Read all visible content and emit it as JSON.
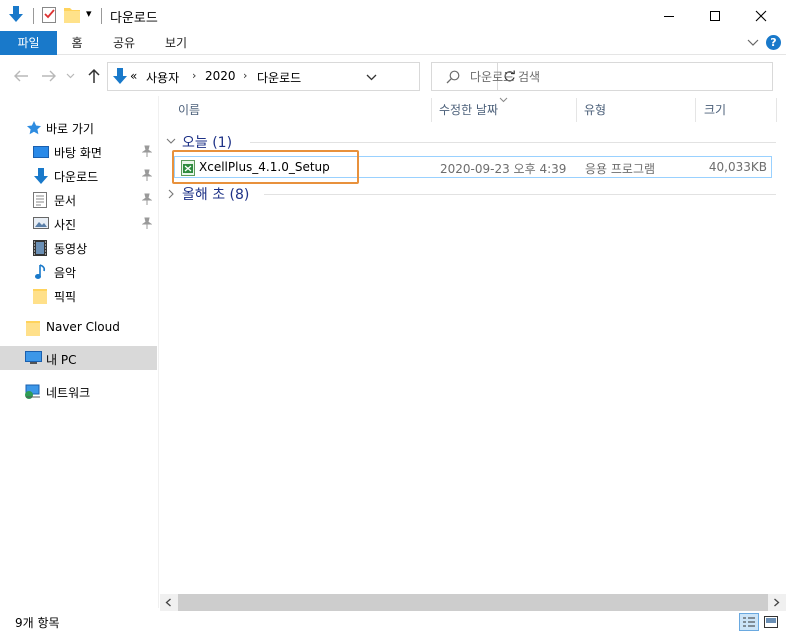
{
  "window": {
    "title": "다운로드",
    "qat_dropdown": "▾"
  },
  "ribbon": {
    "tabs": [
      "파일",
      "홈",
      "공유",
      "보기"
    ],
    "help": "?"
  },
  "address": {
    "overflow": "«",
    "crumbs": [
      "사용자",
      "2020",
      "다운로드"
    ],
    "search_placeholder": "다운로드 검색"
  },
  "nav": {
    "quick_access": "바로 가기",
    "items": [
      {
        "label": "바탕 화면",
        "icon": "desktop-icon",
        "pinned": true
      },
      {
        "label": "다운로드",
        "icon": "download-icon",
        "pinned": true
      },
      {
        "label": "문서",
        "icon": "document-icon",
        "pinned": true
      },
      {
        "label": "사진",
        "icon": "picture-icon",
        "pinned": true
      },
      {
        "label": "동영상",
        "icon": "video-icon",
        "pinned": false
      },
      {
        "label": "음악",
        "icon": "music-icon",
        "pinned": false
      },
      {
        "label": "픽픽",
        "icon": "folder-icon",
        "pinned": false
      }
    ],
    "naver_cloud": "Naver Cloud",
    "this_pc": "내 PC",
    "network": "네트워크"
  },
  "columns": {
    "name": "이름",
    "modified": "수정한 날짜",
    "type": "유형",
    "size": "크기"
  },
  "groups": [
    {
      "label": "오늘 (1)",
      "expanded": true
    },
    {
      "label": "올해 초 (8)",
      "expanded": false
    }
  ],
  "files": [
    {
      "name": "XcellPlus_4.1.0_Setup",
      "modified": "2020-09-23 오후 4:39",
      "type": "응용 프로그램",
      "size": "40,033KB"
    }
  ],
  "status": {
    "item_count": "9개 항목"
  },
  "colors": {
    "accent": "#1979ca",
    "highlight": "#e8913c",
    "group_text": "#1e3287"
  }
}
